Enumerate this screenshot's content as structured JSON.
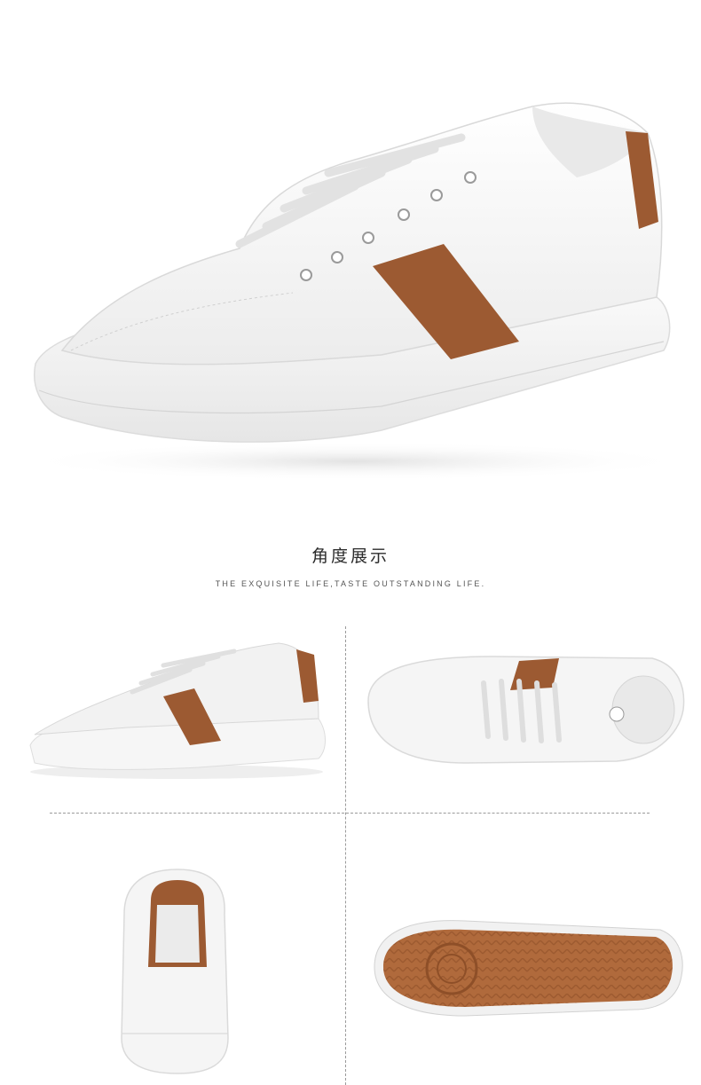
{
  "section": {
    "title": "角度展示",
    "subtitle": "THE EXQUISITE LIFE,TASTE OUTSTANDING LIFE."
  },
  "colors": {
    "upper": "#f4f4f4",
    "sole": "#f7f7f7",
    "stripe": "#9c5a32",
    "outsole": "#b06a3c",
    "text": "#2b2b2b"
  },
  "images": {
    "hero": "white sneaker side view with brown stripe",
    "views": [
      "side view",
      "top view",
      "back view",
      "outsole view"
    ]
  }
}
